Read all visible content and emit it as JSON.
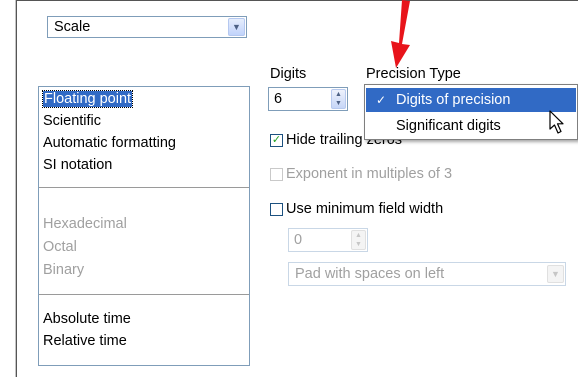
{
  "scale": {
    "value": "Scale"
  },
  "format_list": {
    "items": [
      {
        "label": "Floating point",
        "selected": true,
        "enabled": true
      },
      {
        "label": "Scientific",
        "enabled": true
      },
      {
        "label": "Automatic formatting",
        "enabled": true
      },
      {
        "label": "SI notation",
        "enabled": true
      },
      {
        "label": "Hexadecimal",
        "enabled": false
      },
      {
        "label": "Octal",
        "enabled": false
      },
      {
        "label": "Binary",
        "enabled": false
      },
      {
        "label": "Absolute time",
        "enabled": true
      },
      {
        "label": "Relative time",
        "enabled": true
      }
    ]
  },
  "digits": {
    "label": "Digits",
    "value": "6"
  },
  "precision_type": {
    "label": "Precision Type",
    "options": [
      {
        "label": "Digits of precision",
        "checked": true
      },
      {
        "label": "Significant digits",
        "checked": false
      }
    ],
    "check_glyph": "✓"
  },
  "hide_trailing_zeros": {
    "label": "Hide trailing zeros",
    "checked": true
  },
  "exponent_multiples": {
    "label": "Exponent in multiples of 3",
    "checked": false,
    "enabled": false
  },
  "min_field_width": {
    "label": "Use minimum field width",
    "checked": false,
    "value": "0"
  },
  "pad": {
    "value": "Pad with spaces on left"
  },
  "colors": {
    "selection": "#316ac5",
    "annotation_arrow": "#e8141b",
    "disabled_text": "#a0a0a0"
  },
  "icons": [
    "chevron-down-icon",
    "spinner-arrows-icon",
    "checkmark-icon",
    "mouse-cursor-icon",
    "red-arrow-annotation"
  ]
}
